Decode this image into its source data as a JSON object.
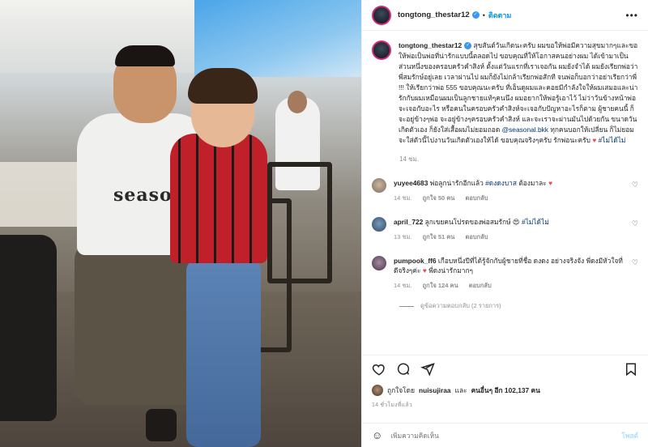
{
  "post": {
    "username": "tongtong_thestar12",
    "follow_label": "ติดตาม",
    "more_label": "•••",
    "caption": {
      "username": "tongtong_thestar12",
      "text": "สุขสันต์วันเกิดนะครับ ผมขอให้พ่อมีความสุขมากๆและขอให้พ่อเป็นพ่อที่น่ารักแบบนี้ตลอดไป ขอบคุณที่ให้โอกาสคนอย่างผม ได้เข้ามาเป็นส่วนหนึ่งของครอบครัวคำสิงห์ ตั้งแต่วันแรกที่เราเจอกัน ผมยังจำได้ ผมยังเรียกพ่อว่าพี่สมรักษ์อยู่เลย เวลาผ่านไป ผมก็ยังไม่กล้าเรียกพ่อสักที จนพ่อก็บอกว่าอย่าเรียกว่าพี่ !!! ให้เรียกว่าพ่อ 555 ขอบคุณนะครับ ที่เอ็นดูผมและคอยมีกำลังใจให้ผมเสมอและน่ารักกับผมเหมือนผมเป็นลูกชายแท้ๆคนนึง ผมอยากให้พ่อรู้เอาไว้ ไม่ว่าวันข้างหน้าพ่อจะเจอกับอะไร หรือคนในครอบครัวคำสิงห์จะเจอกับปัญหาอะไรก็ตาม ผู้ชายคนนี้ ก็จะอยู่ข้างๆพ่อ จะอยู่ข้างๆครอบครัวคำสิงห์ และจะเราจะผ่านมันไปด้วยกัน ขนาดวันเกิดตัวเอง ก็ยังใส่เสื้อผมไม่ยอมถอด",
      "mention": "@seasonal.bkk",
      "text2": "ทุกคนบอกให้เปลี่ยน ก็ไม่ยอม จะใส่ตัวนี้ไปงานวันเกิดตัวเองให้ได้ ขอบคุณจริงๆครับ รักพ่อนะครับ",
      "heart": "♥",
      "hashtag": "#ไม่ได้ไม่"
    },
    "caption_time": "14 ชม.",
    "comments": [
      {
        "user": "yuyee4683",
        "text": "พ่อลูกน่ารักอีกแล้ว",
        "hashtag": "#ดงดงบาส",
        "text2": "ต้องมาละ",
        "emoji": "♥",
        "time": "14 ชม.",
        "likes": "ถูกใจ 50 คน",
        "reply": "ตอบกลับ"
      },
      {
        "user": "april_722",
        "text": "ลูกเขยคนโปรดของพ่อสมรักษ์",
        "emoji": "😍",
        "hashtag": "#ไม่ได้ไม่",
        "text2": "",
        "time": "13 ชม.",
        "likes": "ถูกใจ 51 คน",
        "reply": "ตอบกลับ"
      },
      {
        "user": "pumpook_ff6",
        "text": "เกือบหนึ่งปีที่ได้รู้จักกับผู้ชายที่ชื่อ ดงดง อย่างจริงจัง พี่ดงมีหัวใจที่ดีจริงๆค่ะ",
        "emoji": "♥",
        "hashtag": "",
        "text2": "พี่ดงน่ารักมากๆ",
        "time": "14 ชม.",
        "likes": "ถูกใจ 124 คน",
        "reply": "ตอบกลับ"
      }
    ],
    "view_replies": "ดูข้อความตอบกลับ (2 รายการ)",
    "likes_line": {
      "prefix": "ถูกใจโดย",
      "user": "nuisujiraa",
      "middle": "และ",
      "others": "คนอื่นๆ อีก 102,137 คน"
    },
    "posted_ago": "14 ชั่วโมงที่แล้ว",
    "add_comment_placeholder": "เพิ่มความคิดเห็น",
    "post_label": "โพสต์",
    "photo_shirt_text": "seasona"
  },
  "colors": {
    "accent": "#0095f6",
    "heart": "#ed4956",
    "hashtag": "#00376b",
    "muted": "#8e8e8e"
  }
}
